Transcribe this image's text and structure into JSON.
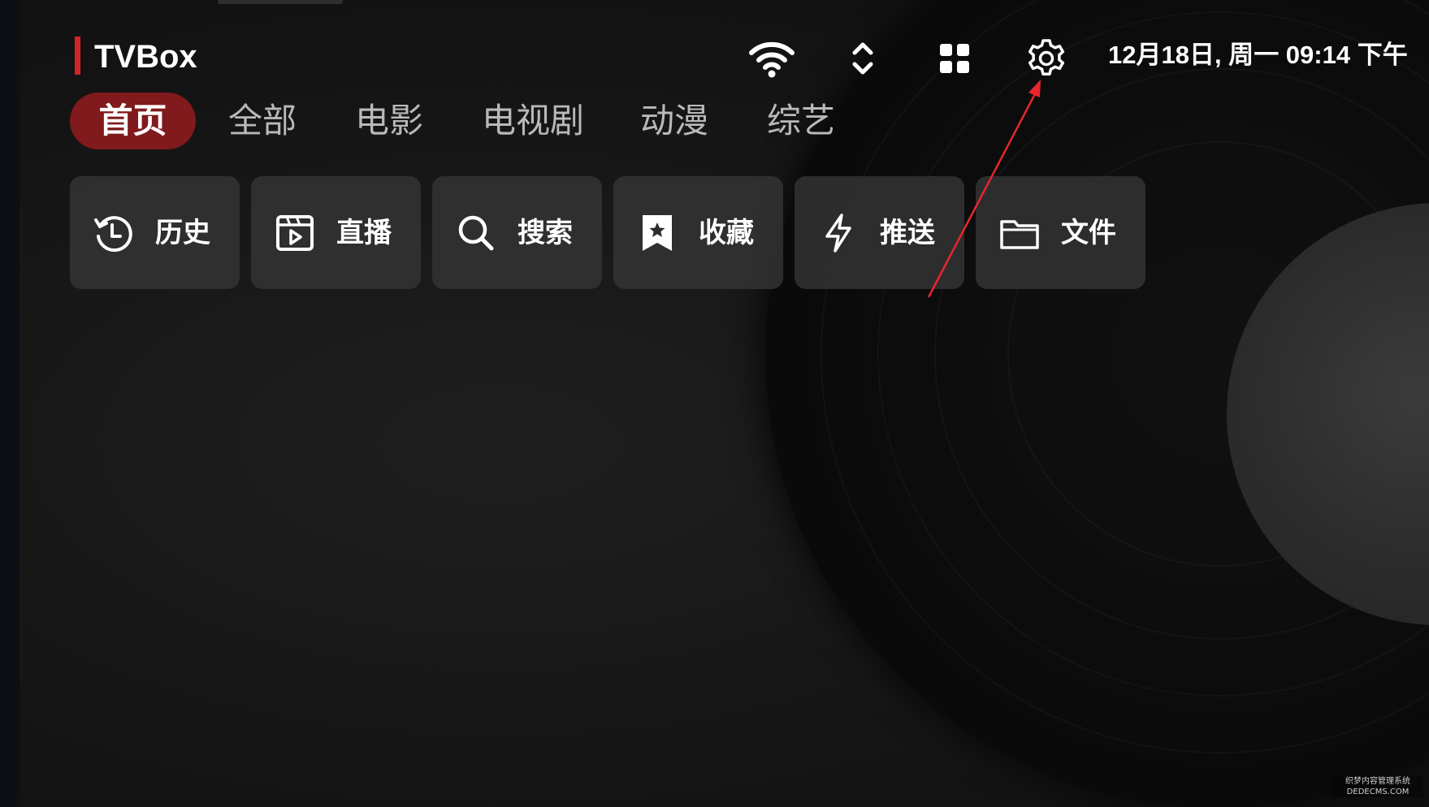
{
  "header": {
    "brand": "TVBox",
    "datetime": "12月18日, 周一 09:14 下午",
    "icons": [
      "wifi-icon",
      "sort-icon",
      "grid-icon",
      "gear-icon"
    ]
  },
  "tabs": [
    {
      "label": "首页",
      "active": true
    },
    {
      "label": "全部",
      "active": false
    },
    {
      "label": "电影",
      "active": false
    },
    {
      "label": "电视剧",
      "active": false
    },
    {
      "label": "动漫",
      "active": false
    },
    {
      "label": "综艺",
      "active": false
    }
  ],
  "quick_actions": [
    {
      "label": "历史",
      "icon": "history-icon"
    },
    {
      "label": "直播",
      "icon": "live-tv-icon"
    },
    {
      "label": "搜索",
      "icon": "search-icon"
    },
    {
      "label": "收藏",
      "icon": "bookmark-star-icon"
    },
    {
      "label": "推送",
      "icon": "lightning-icon"
    },
    {
      "label": "文件",
      "icon": "folder-icon"
    }
  ],
  "watermark": {
    "line1": "织梦内容管理系统",
    "line2": "DEDECMS.COM"
  },
  "colors": {
    "accent": "#d8222a",
    "active_tab_bg": "#801a1c",
    "button_bg": "#343434",
    "annotation_arrow": "#e8262c"
  }
}
